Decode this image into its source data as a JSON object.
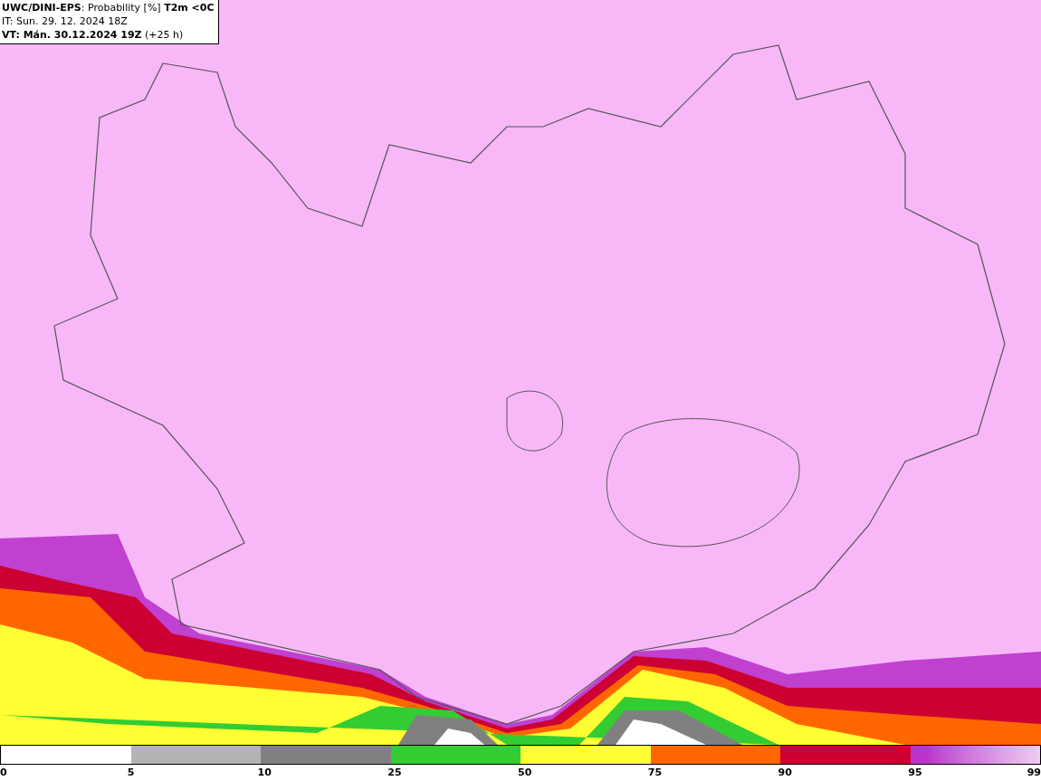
{
  "header": {
    "lines": [
      "**UWC/DINI-EPS**: Probability [%] **T2m <0C**",
      "IT: Sun. 29. 12. 2024 18Z",
      "**VT: Mán. 30.12.2024 19Z** (+25 h)"
    ]
  },
  "legend": {
    "segments": [
      {
        "kind": "solid",
        "color": "#ffffff"
      },
      {
        "kind": "solid",
        "color": "#b4b4b4"
      },
      {
        "kind": "solid",
        "color": "#808080"
      },
      {
        "kind": "solid",
        "color": "#33cc33"
      },
      {
        "kind": "solid",
        "color": "#ffff33"
      },
      {
        "kind": "solid",
        "color": "#ff6600"
      },
      {
        "kind": "solid",
        "color": "#cc0033"
      },
      {
        "kind": "gradient",
        "color": "#bb33cc"
      }
    ],
    "labels": [
      "0",
      "5",
      "10",
      "25",
      "50",
      "75",
      "90",
      "95",
      "99"
    ]
  }
}
